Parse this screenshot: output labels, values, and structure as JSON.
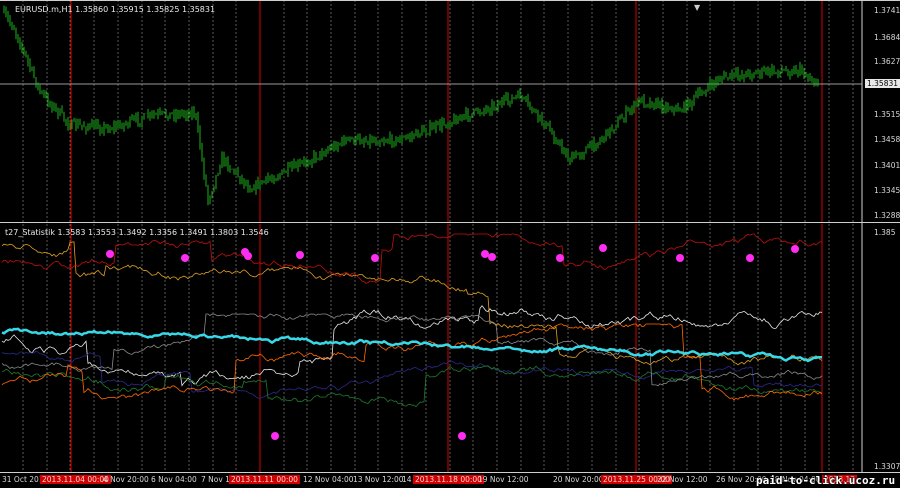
{
  "main_pane": {
    "title": "EURUSD.m,H1  1.35860 1.35915 1.35825 1.35831",
    "price_labels": [
      "1.37415",
      "1.36845",
      "1.36275",
      "1.35705",
      "1.35150",
      "1.34580",
      "1.34010",
      "1.33455",
      "1.32885"
    ],
    "bid_label": "1.35831",
    "colors": {
      "candles": "#1bb21b",
      "bid_line": "#9a9a9a"
    }
  },
  "indicator_pane": {
    "title": "t27_Statistik  1.3583 1.3553 1.3492 1.3356 1.3491 1.3803 1.3546",
    "price_labels": [
      "1.385",
      "1.3307"
    ],
    "colors": {
      "main_line": "#37d9e8",
      "markers": "#ff2cf2",
      "lines": [
        "#e0a020",
        "#c01010",
        "#e8e8e8",
        "#2a2a8a",
        "#1f7a2f",
        "#8a8a8a",
        "#ff6a00"
      ]
    }
  },
  "time_axis": {
    "labels": [
      "31 Oct 2013",
      "2013.11.04 00:00",
      "4 Nov 20:00",
      "6 Nov 04:00",
      "7 Nov 12:00",
      "2013.11.11 00:00",
      "12 Nov 04:00",
      "13 Nov 12:00",
      "14 Nov",
      "2013.11.18 00:00",
      "19 Nov 12:00",
      "20 Nov 20:00",
      "2013.11.25 00:00",
      "22 Nov 12:00",
      "26 Nov 20:00",
      "28 Nov 04:00",
      "2013.12"
    ],
    "highlighted": [
      "2013.11.04 00:00",
      "2013.11.11 00:00",
      "2013.11.18 00:00",
      "2013.11.25 00:00",
      "2013.12"
    ]
  },
  "watermark": "paid-to-click.ucoz.ru",
  "icons": {
    "scroll": "triangle-down-icon"
  },
  "colors": {
    "grid": "#5a5a5a",
    "separator": "#d40000",
    "background": "#000000"
  }
}
